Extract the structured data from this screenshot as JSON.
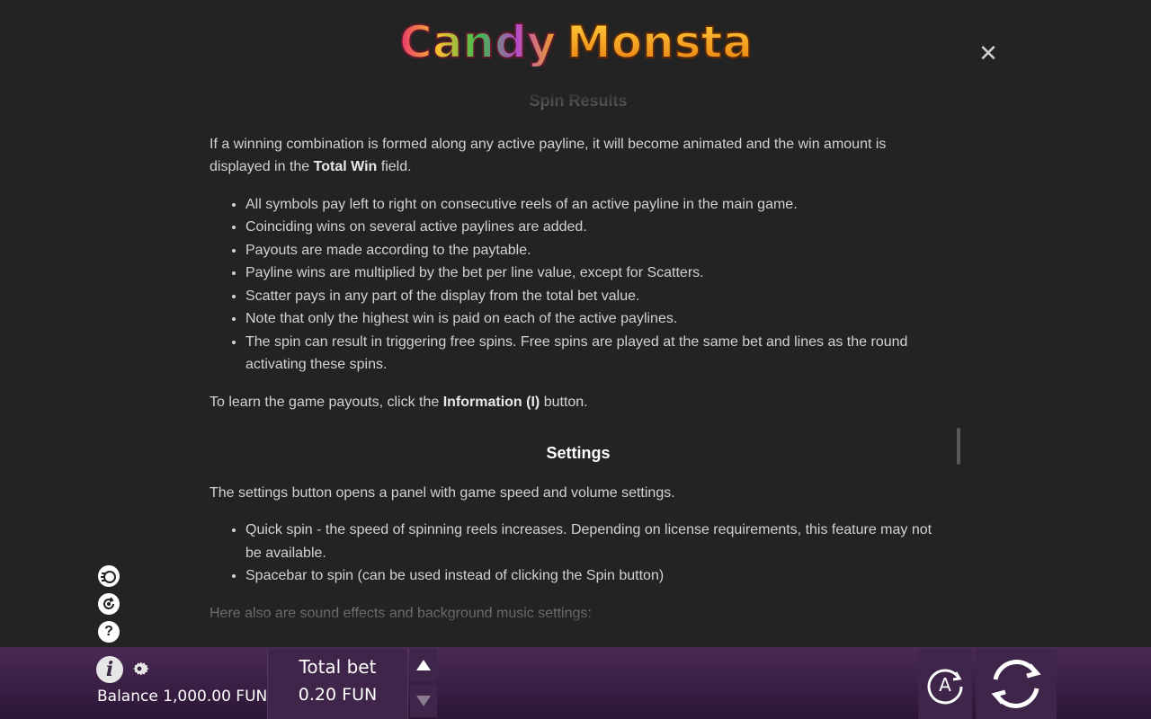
{
  "logo": {
    "text_left": "Candy",
    "text_right": "Monsta"
  },
  "close": {
    "glyph": "✕"
  },
  "help": {
    "spin_results_title": "Spin Results",
    "intro_before": "If a winning combination is formed along any active payline, it will become animated and the win amount is displayed in the ",
    "intro_bold": "Total Win",
    "intro_after": " field.",
    "rules": [
      "All symbols pay left to right on consecutive reels of an active payline in the main game.",
      "Coinciding wins on several active paylines are added.",
      "Payouts are made according to the paytable.",
      "Payline wins are multiplied by the bet per line value, except for Scatters.",
      "Scatter pays in any part of the display from the total bet value.",
      "Note that only the highest win is paid on each of the active paylines.",
      "The spin can result in triggering free spins. Free spins are played at the same bet and lines as the round activating these spins."
    ],
    "payouts_before": "To learn the game payouts, click the ",
    "payouts_bold": "Information (I)",
    "payouts_after": " button.",
    "settings_title": "Settings",
    "settings_intro": "The settings button opens a panel with game speed and volume settings.",
    "settings_items": [
      "Quick spin - the speed of spinning reels increases. Depending on license requirements, this feature may not be available.",
      "Spacebar to spin (can be used instead of clicking the Spin button)"
    ],
    "sound_line": "Here also are sound effects and background music settings:"
  },
  "side_icons": {
    "help_glyph": "?"
  },
  "bottom": {
    "info_glyph": "i",
    "balance_text": "Balance 1,000.00 FUN",
    "total_bet_label": "Total bet",
    "total_bet_value": "0.20 FUN",
    "auto_label": "A"
  },
  "colors": {
    "background": "#232323",
    "bottom_bar": "#3e2549",
    "text": "#d2d2d2"
  }
}
